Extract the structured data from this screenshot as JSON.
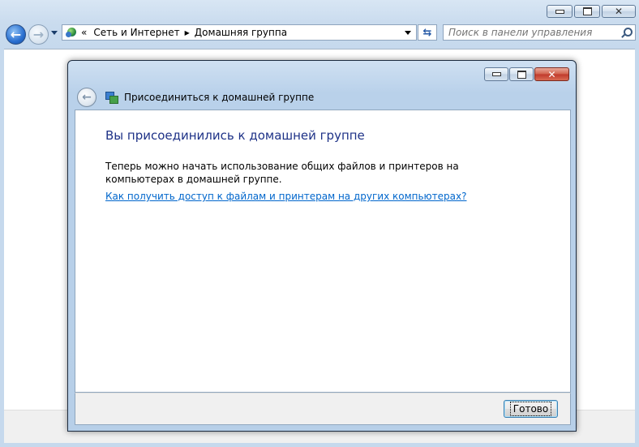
{
  "explorer": {
    "breadcrumb": {
      "overflow": "«",
      "items": [
        "Сеть и Интернет",
        "Домашняя группа"
      ]
    },
    "search": {
      "placeholder": "Поиск в панели управления"
    }
  },
  "dialog": {
    "title": "Присоединиться к домашней группе",
    "heading": "Вы присоединились к домашней группе",
    "description": "Теперь можно начать использование общих файлов и принтеров на компьютерах в домашней группе.",
    "link": "Как получить доступ к файлам и принтерам на других компьютерах?",
    "finish_button": "Готово"
  },
  "icons": {
    "back": "back-arrow-icon",
    "forward": "forward-arrow-icon",
    "network": "network-globe-icon",
    "refresh": "refresh-icon",
    "search": "search-icon",
    "homegroup": "homegroup-icon"
  },
  "colors": {
    "heading": "#1e3287",
    "link": "#0066cc",
    "close_button": "#c0392b"
  }
}
